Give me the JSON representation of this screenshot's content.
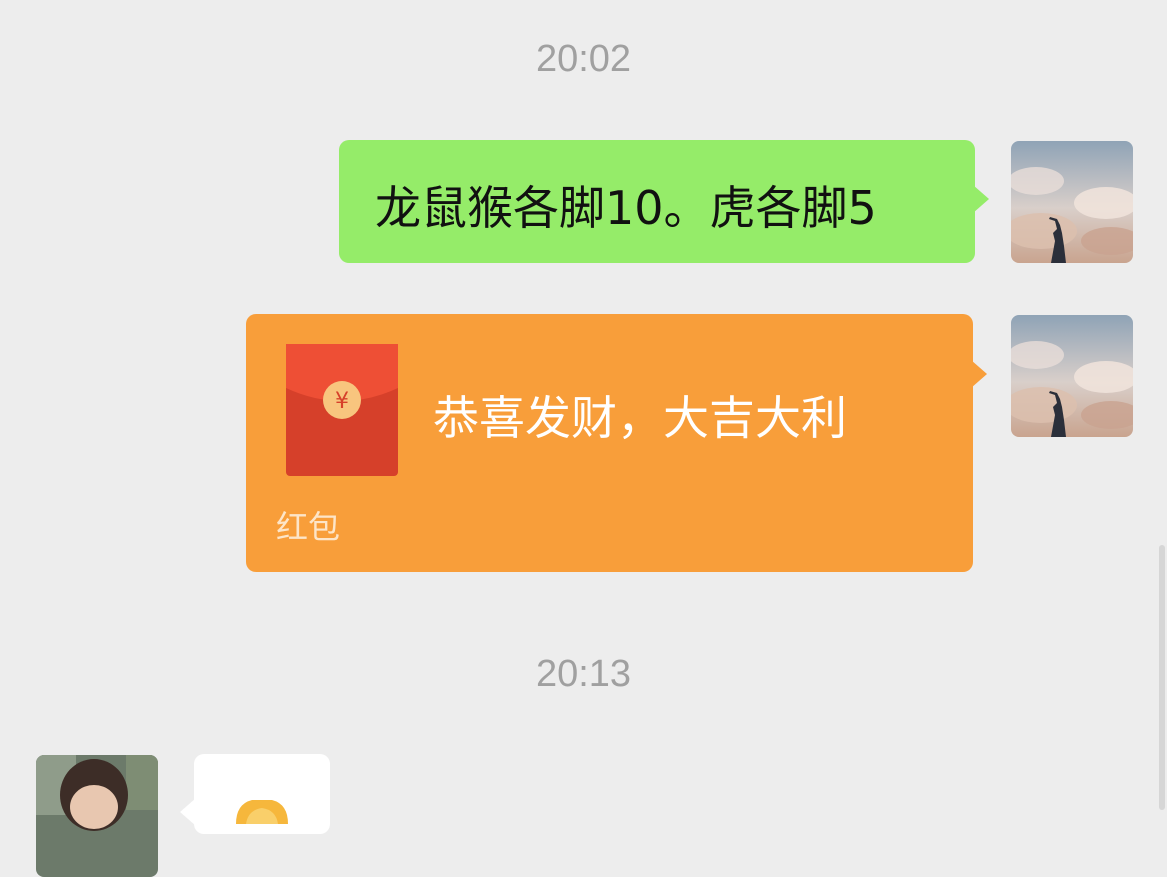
{
  "chat": {
    "messages": [
      {
        "timestamp": "20:02"
      },
      {
        "text": "龙鼠猴各脚10。虎各脚5"
      },
      {
        "type": "red-packet",
        "greeting": "恭喜发财，大吉大利",
        "label": "红包"
      },
      {
        "timestamp": "20:13"
      }
    ]
  },
  "colors": {
    "background": "#ededed",
    "my_bubble": "#95ec69",
    "red_packet": "#f89e3a",
    "timestamp": "#a0a0a0"
  },
  "icons": {
    "red_packet": "red-envelope-icon",
    "yuan": "yuan-coin-icon"
  }
}
